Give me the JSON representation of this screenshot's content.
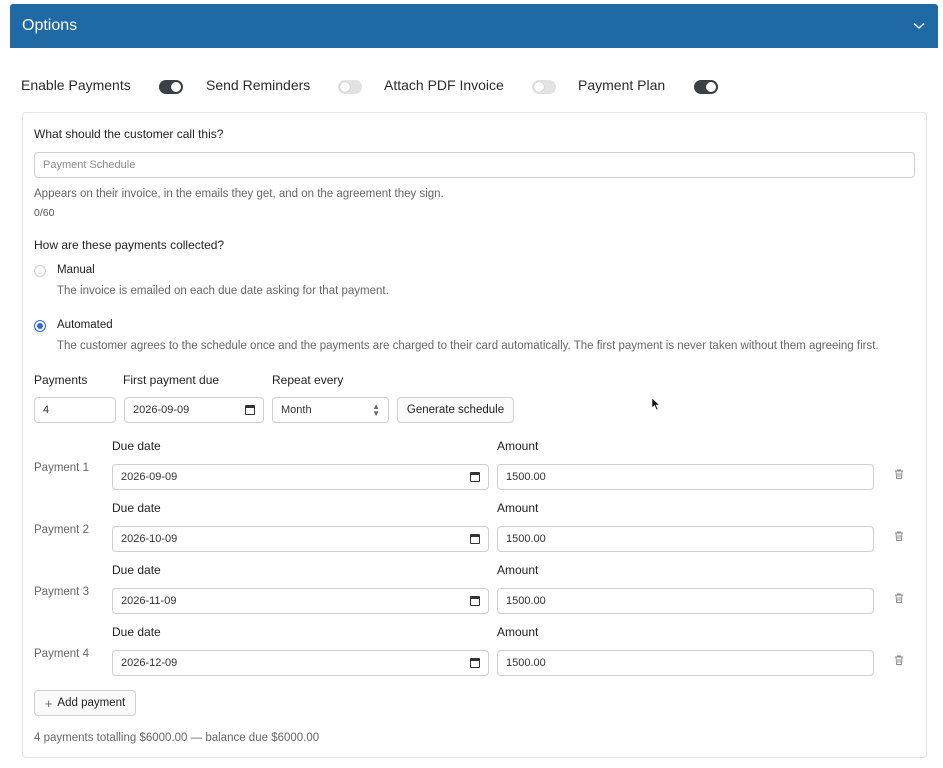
{
  "header": {
    "title": "Options",
    "chevron_icon": "chevron-down-icon"
  },
  "toggles": [
    {
      "label": "Enable Payments",
      "on": true
    },
    {
      "label": "Send Reminders",
      "on": false
    },
    {
      "label": "Attach PDF Invoice",
      "on": false
    },
    {
      "label": "Payment Plan",
      "on": true
    }
  ],
  "name_field": {
    "label": "What should the customer call this?",
    "placeholder": "Payment Schedule",
    "value": "",
    "help": "Appears on their invoice, in the emails they get, and on the agreement they sign.",
    "counter": "0/60"
  },
  "collection": {
    "question": "How are these payments collected?",
    "options": [
      {
        "title": "Manual",
        "desc": "The invoice is emailed on each due date asking for that payment.",
        "selected": false
      },
      {
        "title": "Automated",
        "desc": "The customer agrees to the schedule once and the payments are charged to their card automatically. The first payment is never taken without them agreeing first.",
        "selected": true
      }
    ]
  },
  "schedule": {
    "payments_label": "Payments",
    "payments_value": "4",
    "first_due_label": "First payment due",
    "first_due_value": "2026-09-09",
    "repeat_label": "Repeat every",
    "repeat_value": "Month",
    "generate_label": "Generate schedule"
  },
  "rows": [
    {
      "label": "Payment 1",
      "due_label": "Due date",
      "due": "2026-09-09",
      "amount_label": "Amount",
      "amount": "1500.00"
    },
    {
      "label": "Payment 2",
      "due_label": "Due date",
      "due": "2026-10-09",
      "amount_label": "Amount",
      "amount": "1500.00"
    },
    {
      "label": "Payment 3",
      "due_label": "Due date",
      "due": "2026-11-09",
      "amount_label": "Amount",
      "amount": "1500.00"
    },
    {
      "label": "Payment 4",
      "due_label": "Due date",
      "due": "2026-12-09",
      "amount_label": "Amount",
      "amount": "1500.00"
    }
  ],
  "add_payment": {
    "icon": "plus-icon",
    "label": "Add payment"
  },
  "summary": "4 payments totalling $6000.00 — balance due $6000.00",
  "colors": {
    "header_bg": "#1f6aa5",
    "toggle_on": "#3b3f46",
    "radio_accent": "#2f6bd8"
  }
}
